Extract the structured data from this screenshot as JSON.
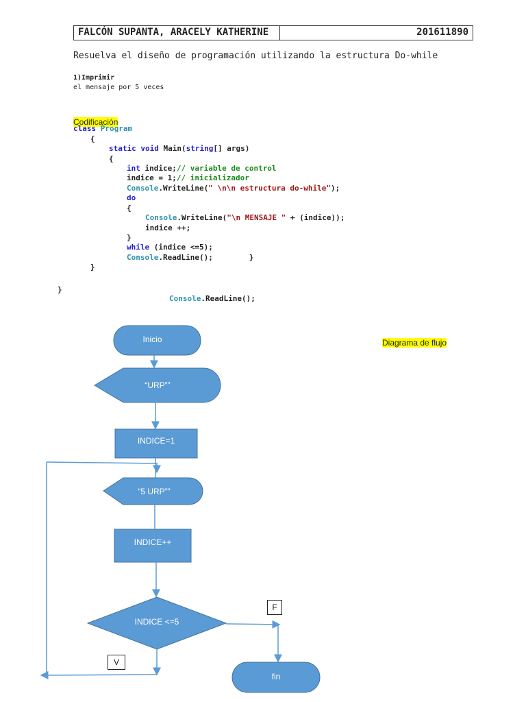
{
  "header": {
    "name": "FALCÓN SUPANTA, ARACELY KATHERINE",
    "id": "201611890"
  },
  "instruction": "Resuelva el diseño de programación utilizando la estructura Do-while",
  "task": {
    "line1": "1)Imprimir",
    "line2": "el mensaje por 5 veces"
  },
  "code_heading": "Codificación",
  "code": {
    "class_kw": "class",
    "class_name": "Program",
    "brace_open": "{",
    "brace_close": "}",
    "static_kw": "static void",
    "main_sig": " Main(",
    "string_kw": "string",
    "args": "[] args)",
    "int_kw": "int",
    "int_rest": " indice;",
    "cm1": "// variable de control",
    "init": "indice = 1;",
    "cm2": "// inicializador",
    "console": "Console",
    "writeline": ".WriteLine(",
    "str1": "\" \\n\\n estructura do-while\"",
    "end": ");",
    "do_kw": "do",
    "str2": "\"\\n MENSAJE \"",
    "concat": " + (indice));",
    "incr": "indice ++;",
    "while_kw": "while",
    "while_cond": " (indice <=5);",
    "readline": ".ReadLine();",
    "readline_brace": ".ReadLine();        }"
  },
  "diagram": {
    "title": "Diagrama de flujo",
    "start": "Inicio",
    "output1": "“URP””",
    "assign": "INDICE=1",
    "output2": "“5 URP””",
    "increment": "INDICE++",
    "decision": "INDICE <=5",
    "end": "fin",
    "false_label": "F",
    "true_label": "V",
    "fill": "#5b9bd5",
    "stroke": "#41719c"
  }
}
